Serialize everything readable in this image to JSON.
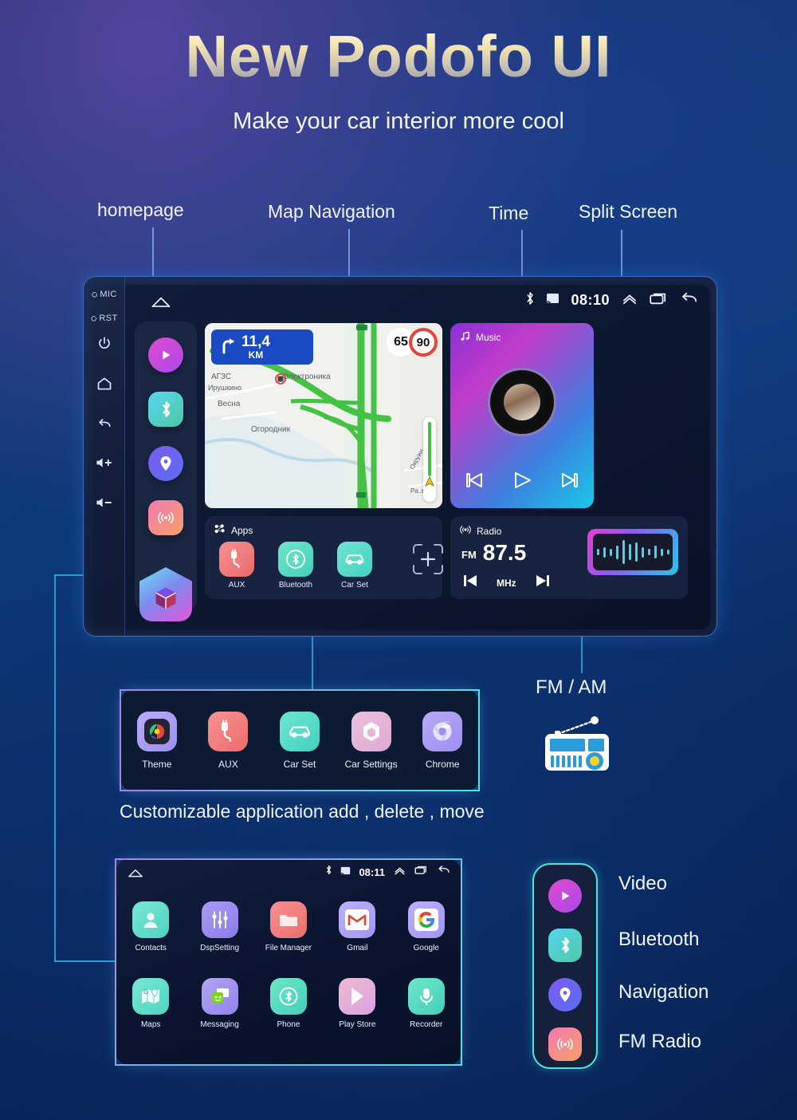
{
  "header": {
    "title": "New Podofo UI",
    "subtitle": "Make your car interior more cool"
  },
  "callouts": [
    {
      "id": "homepage",
      "label": "homepage"
    },
    {
      "id": "map-navigation",
      "label": "Map Navigation"
    },
    {
      "id": "time",
      "label": "Time"
    },
    {
      "id": "split-screen",
      "label": "Split Screen"
    }
  ],
  "head_unit": {
    "bezel": {
      "mic_label": "MIC",
      "rst_label": "RST",
      "icons": [
        "power-icon",
        "home-icon",
        "back-icon",
        "volume-up-icon",
        "volume-down-icon"
      ],
      "volume_up_label": "+",
      "volume_down_label": "−"
    },
    "status_bar": {
      "home_icon": "home-icon",
      "bluetooth_icon": "bluetooth-icon",
      "cast_icon": "cast-icon",
      "time": "08:10",
      "chevron_up_icon": "chevron-up-icon",
      "split_screen_icon": "split-screen-icon",
      "back_icon": "back-icon"
    },
    "sidebar": [
      {
        "name": "video",
        "icon": "play-icon",
        "color": "#d643c8"
      },
      {
        "name": "bluetooth",
        "icon": "bluetooth-icon",
        "color": "#3fd6c8"
      },
      {
        "name": "navigation",
        "icon": "location-pin-icon",
        "color": "#7a5cf0"
      },
      {
        "name": "fm-radio",
        "icon": "radio-wave-icon",
        "color": "#f0847a"
      }
    ],
    "drawer_button": {
      "icon": "cube-icon"
    },
    "map": {
      "nav_distance": "11,4",
      "nav_unit": "KM",
      "turn_icon": "turn-right-icon",
      "current_speed": "65",
      "speed_limit": "90",
      "labels": [
        "АГЗС",
        "Ирушкино",
        "Весна",
        "Электроника",
        "Огородник",
        "Окружн",
        "Ра..ве"
      ],
      "route_color": "#45c246"
    },
    "music": {
      "title": "Music",
      "music_note_icon": "music-note-icon",
      "prev_icon": "prev-track-icon",
      "play_icon": "play-icon",
      "next_icon": "next-track-icon"
    },
    "apps_widget": {
      "title": "Apps",
      "grid_icon": "apps-grid-icon",
      "items": [
        {
          "label": "AUX",
          "icon": "aux-plug-icon",
          "color1": "#f38080",
          "color2": "#ec6a6a"
        },
        {
          "label": "Bluetooth",
          "icon": "bluetooth-icon",
          "color1": "#5fe0c0",
          "color2": "#3fd0bb"
        },
        {
          "label": "Car Set",
          "icon": "car-icon",
          "color1": "#5fe0c8",
          "color2": "#45cfc0"
        }
      ],
      "add_label": "+",
      "add_icon": "add-app-icon"
    },
    "radio_widget": {
      "title": "Radio",
      "radio_icon": "radio-tower-icon",
      "band": "FM",
      "frequency": "87.5",
      "unit": "MHz",
      "prev_icon": "prev-station-icon",
      "next_icon": "next-station-icon",
      "eq_icon": "equalizer-icon"
    }
  },
  "app_strip": {
    "items": [
      {
        "label": "Theme",
        "icon": "theme-icon",
        "color1": "#b2a6f2",
        "color2": "#9f93ee"
      },
      {
        "label": "AUX",
        "icon": "aux-plug-icon",
        "color1": "#f58181",
        "color2": "#ed6a6a"
      },
      {
        "label": "Car Set",
        "icon": "car-icon",
        "color1": "#5fe2c9",
        "color2": "#44d1bf"
      },
      {
        "label": "Car Settings",
        "icon": "gear-hex-icon",
        "color1": "#e8b8d8",
        "color2": "#dca8d0"
      },
      {
        "label": "Chrome",
        "icon": "chrome-icon",
        "color1": "#b0a4f4",
        "color2": "#9b8df0"
      }
    ],
    "caption": "Customizable application add , delete , move"
  },
  "app_drawer": {
    "status_bar": {
      "home_icon": "home-icon",
      "bluetooth_icon": "bluetooth-icon",
      "cast_icon": "cast-icon",
      "time": "08:11",
      "chevron_up_icon": "chevron-up-icon",
      "split_screen_icon": "split-screen-icon",
      "back_icon": "back-icon"
    },
    "row1": [
      {
        "label": "Contacts",
        "icon": "contacts-icon",
        "color1": "#6fe3cf",
        "color2": "#4fd4c2"
      },
      {
        "label": "DspSetting",
        "icon": "sliders-icon",
        "color1": "#9f93ee",
        "color2": "#8a7ce8"
      },
      {
        "label": "File Manager",
        "icon": "folder-icon",
        "color1": "#f58181",
        "color2": "#ee6d6d"
      },
      {
        "label": "Gmail",
        "icon": "gmail-icon",
        "color1": "#b3a6f3",
        "color2": "#a093ef"
      },
      {
        "label": "Google",
        "icon": "google-icon",
        "color1": "#b3a6f3",
        "color2": "#a093ef"
      }
    ],
    "row2": [
      {
        "label": "Maps",
        "icon": "maps-icon",
        "color1": "#6fe3cf",
        "color2": "#4fd4c2"
      },
      {
        "label": "Messaging",
        "icon": "messaging-icon",
        "color1": "#a99bf0",
        "color2": "#8f80ea"
      },
      {
        "label": "Phone",
        "icon": "bluetooth-phone-icon",
        "color1": "#5fe0c4",
        "color2": "#42cfbb"
      },
      {
        "label": "Play Store",
        "icon": "play-store-icon",
        "color1": "#eeb4cd",
        "color2": "#d9a2e0"
      },
      {
        "label": "Recorder",
        "icon": "microphone-icon",
        "color1": "#5fe0c4",
        "color2": "#42cfbb"
      }
    ]
  },
  "fm_am": {
    "label": "FM / AM",
    "icon": "radio-device-icon"
  },
  "legend": {
    "items": [
      {
        "label": "Video",
        "icon": "play-icon",
        "color": "#d643c8"
      },
      {
        "label": "Bluetooth",
        "icon": "bluetooth-icon",
        "color": "#3fd6c8"
      },
      {
        "label": "Navigation",
        "icon": "location-pin-icon",
        "color": "#7a5cf0"
      },
      {
        "label": "FM Radio",
        "icon": "radio-wave-icon",
        "color": "#f0847a"
      }
    ]
  },
  "colors": {
    "background_deep": "#07204c",
    "accent_cyan": "#4fe3e0",
    "accent_purple": "#a682f0",
    "callout_dot": "#1f7ddd",
    "title_gold": "#f2e3ae"
  }
}
